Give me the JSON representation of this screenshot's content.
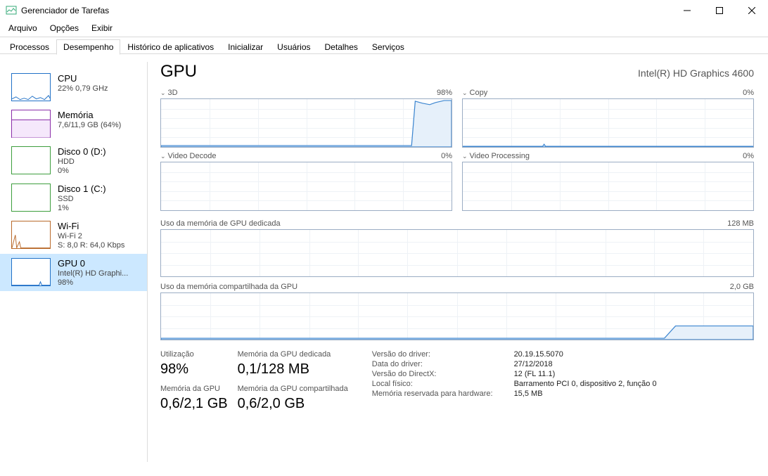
{
  "window": {
    "title": "Gerenciador de Tarefas"
  },
  "menu": {
    "arquivo": "Arquivo",
    "opcoes": "Opções",
    "exibir": "Exibir"
  },
  "tabs": {
    "processos": "Processos",
    "desempenho": "Desempenho",
    "historico": "Histórico de aplicativos",
    "inicializar": "Inicializar",
    "usuarios": "Usuários",
    "detalhes": "Detalhes",
    "servicos": "Serviços"
  },
  "sidebar": {
    "items": [
      {
        "name": "CPU",
        "sub1": "22% 0,79 GHz",
        "color": "#2171c7"
      },
      {
        "name": "Memória",
        "sub1": "7,6/11,9 GB (64%)",
        "color": "#8a2da8"
      },
      {
        "name": "Disco 0 (D:)",
        "sub1": "HDD",
        "sub2": "0%",
        "color": "#3d9e3d"
      },
      {
        "name": "Disco 1 (C:)",
        "sub1": "SSD",
        "sub2": "1%",
        "color": "#3d9e3d"
      },
      {
        "name": "Wi-Fi",
        "sub1": "Wi-Fi 2",
        "sub2": "S: 8,0 R: 64,0 Kbps",
        "color": "#b96a2b"
      },
      {
        "name": "GPU 0",
        "sub1": "Intel(R) HD Graphi...",
        "sub2": "98%",
        "color": "#2171c7"
      }
    ]
  },
  "main": {
    "title": "GPU",
    "subtitle": "Intel(R) HD Graphics 4600",
    "graphs": {
      "g3d": {
        "label": "3D",
        "right": "98%"
      },
      "copy": {
        "label": "Copy",
        "right": "0%"
      },
      "vdec": {
        "label": "Video Decode",
        "right": "0%"
      },
      "vproc": {
        "label": "Video Processing",
        "right": "0%"
      },
      "dedmem": {
        "label": "Uso da memória de GPU dedicada",
        "right": "128 MB"
      },
      "sharedmem": {
        "label": "Uso da memória compartilhada da GPU",
        "right": "2,0 GB"
      }
    },
    "stats": {
      "util_label": "Utilização",
      "util_value": "98%",
      "dedmem_label": "Memória da GPU dedicada",
      "dedmem_value": "0,1/128 MB",
      "gpumem_label": "Memória da GPU",
      "gpumem_value": "0,6/2,1 GB",
      "sharedmem_label": "Memória da GPU compartilhada",
      "sharedmem_value": "0,6/2,0 GB"
    },
    "details": {
      "k1": "Versão do driver:",
      "v1": "20.19.15.5070",
      "k2": "Data do driver:",
      "v2": "27/12/2018",
      "k3": "Versão do DirectX:",
      "v3": "12 (FL 11.1)",
      "k4": "Local físico:",
      "v4": "Barramento PCI 0, dispositivo 2, função 0",
      "k5": "Memória reservada para hardware:",
      "v5": "15,5 MB"
    }
  },
  "chart_data": [
    {
      "type": "area",
      "name": "3D",
      "ylim": [
        0,
        100
      ],
      "unit": "%",
      "values_recent_approx": [
        2,
        2,
        2,
        3,
        2,
        2,
        2,
        2,
        3,
        2,
        2,
        2,
        3,
        2,
        2,
        2,
        3,
        2,
        2,
        2,
        2,
        2,
        2,
        3,
        2,
        2,
        2,
        2,
        2,
        2,
        2,
        2,
        2,
        2,
        2,
        2,
        2,
        2,
        2,
        2,
        2,
        2,
        2,
        2,
        2,
        2,
        2,
        2,
        2,
        2,
        2,
        3,
        2,
        98,
        95,
        92,
        94,
        96,
        98,
        98
      ]
    },
    {
      "type": "area",
      "name": "Copy",
      "ylim": [
        0,
        100
      ],
      "unit": "%",
      "values_recent_approx": [
        0,
        0,
        0,
        0,
        0,
        0,
        0,
        0,
        0,
        0,
        0,
        0,
        0,
        0,
        0,
        0,
        1,
        0,
        0,
        0,
        0,
        0,
        0,
        0,
        0,
        0,
        0,
        0,
        0,
        0,
        0,
        0,
        0,
        0,
        0,
        0,
        0,
        0,
        0,
        0,
        0,
        0,
        0,
        0,
        0,
        0,
        0,
        0,
        0,
        0,
        0,
        0,
        0,
        0,
        0,
        0,
        0,
        0,
        0,
        0
      ]
    },
    {
      "type": "area",
      "name": "Video Decode",
      "ylim": [
        0,
        100
      ],
      "unit": "%",
      "values_recent_approx": [
        0,
        0,
        0,
        0,
        0,
        0,
        0,
        0,
        0,
        0,
        0,
        0,
        0,
        0,
        0,
        0,
        0,
        0,
        0,
        0,
        0,
        0,
        0,
        0,
        0,
        0,
        0,
        0,
        0,
        0,
        0,
        0,
        0,
        0,
        0,
        0,
        0,
        0,
        0,
        0,
        0,
        0,
        0,
        0,
        0,
        0,
        0,
        0,
        0,
        0,
        0,
        0,
        0,
        0,
        0,
        0,
        0,
        0,
        0,
        0
      ]
    },
    {
      "type": "area",
      "name": "Video Processing",
      "ylim": [
        0,
        100
      ],
      "unit": "%",
      "values_recent_approx": [
        0,
        0,
        0,
        0,
        0,
        0,
        0,
        0,
        0,
        0,
        0,
        0,
        0,
        0,
        0,
        0,
        0,
        0,
        0,
        0,
        0,
        0,
        0,
        0,
        0,
        0,
        0,
        0,
        0,
        0,
        0,
        0,
        0,
        0,
        0,
        0,
        0,
        0,
        0,
        0,
        0,
        0,
        0,
        0,
        0,
        0,
        0,
        0,
        0,
        0,
        0,
        0,
        0,
        0,
        0,
        0,
        0,
        0,
        0,
        0
      ]
    },
    {
      "type": "area",
      "name": "Dedicated GPU memory",
      "ylim": [
        0,
        128
      ],
      "unit": "MB",
      "values_recent_approx": [
        0.1,
        0.1,
        0.1,
        0.1,
        0.1,
        0.1,
        0.1,
        0.1,
        0.1,
        0.1,
        0.1,
        0.1,
        0.1,
        0.1,
        0.1,
        0.1,
        0.1,
        0.1,
        0.1,
        0.1,
        0.1,
        0.1,
        0.1,
        0.1,
        0.1,
        0.1,
        0.1,
        0.1,
        0.1,
        0.1,
        0.1,
        0.1,
        0.1,
        0.1,
        0.1,
        0.1,
        0.1,
        0.1,
        0.1,
        0.1,
        0.1,
        0.1,
        0.1,
        0.1,
        0.1,
        0.1,
        0.1,
        0.1,
        0.1,
        0.1,
        0.1,
        0.1,
        0.1,
        0.1,
        0.1,
        0.1,
        0.1,
        0.1,
        0.1,
        0.1
      ]
    },
    {
      "type": "area",
      "name": "Shared GPU memory",
      "ylim": [
        0,
        2.0
      ],
      "unit": "GB",
      "values_recent_approx": [
        0.05,
        0.05,
        0.05,
        0.05,
        0.05,
        0.05,
        0.05,
        0.05,
        0.05,
        0.05,
        0.05,
        0.05,
        0.05,
        0.05,
        0.05,
        0.05,
        0.05,
        0.05,
        0.05,
        0.05,
        0.05,
        0.05,
        0.05,
        0.05,
        0.05,
        0.05,
        0.05,
        0.05,
        0.05,
        0.05,
        0.05,
        0.05,
        0.05,
        0.05,
        0.05,
        0.05,
        0.05,
        0.05,
        0.05,
        0.05,
        0.05,
        0.05,
        0.05,
        0.05,
        0.05,
        0.05,
        0.05,
        0.05,
        0.05,
        0.05,
        0.05,
        0.05,
        0.05,
        0.6,
        0.6,
        0.6,
        0.6,
        0.6,
        0.6,
        0.6
      ]
    }
  ]
}
